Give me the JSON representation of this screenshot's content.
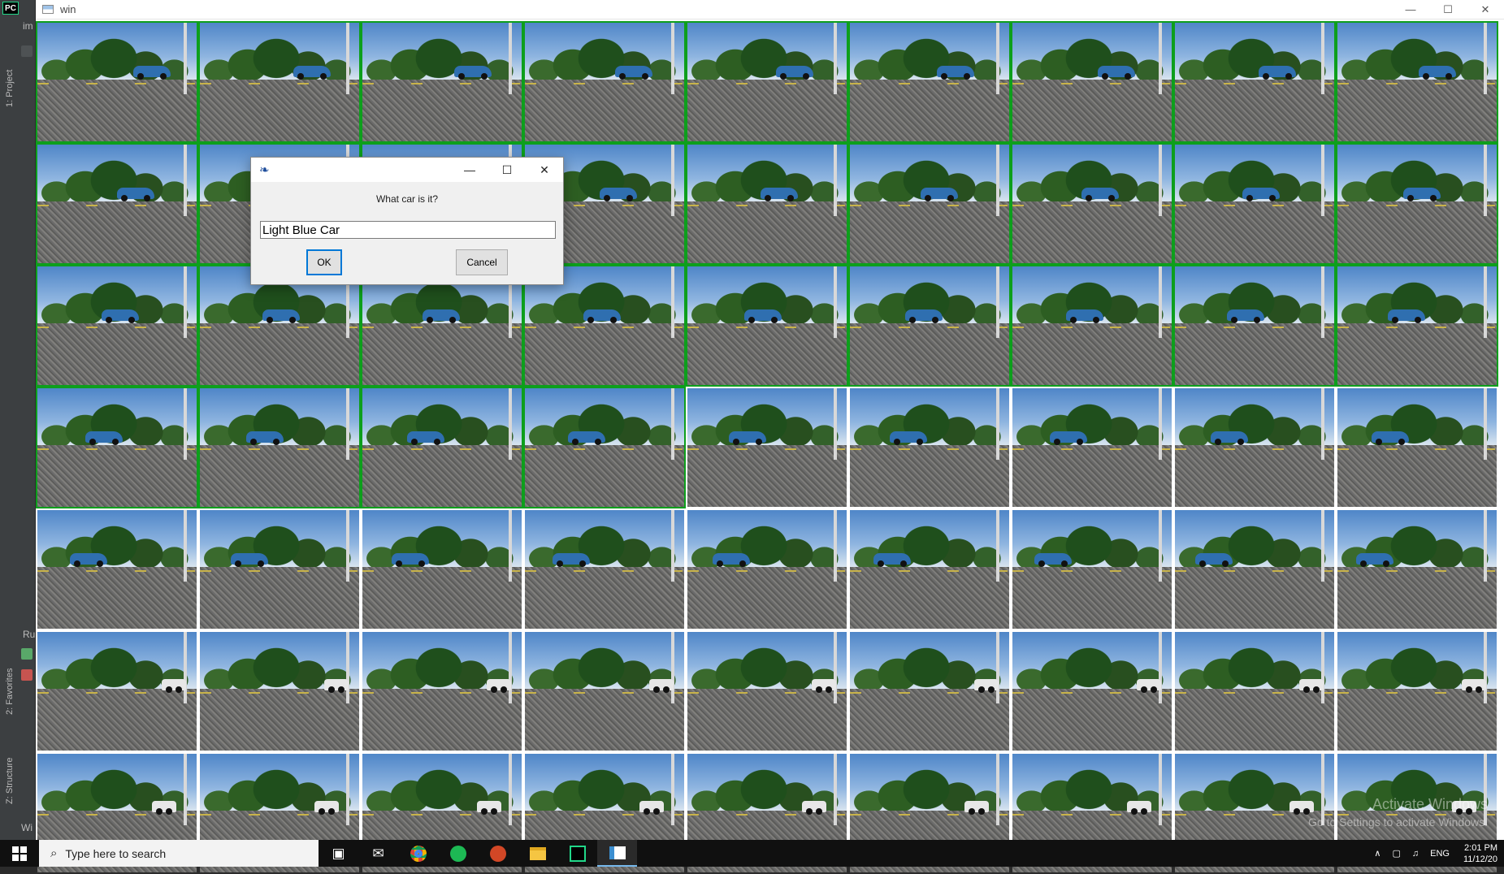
{
  "ide": {
    "logo": "PC",
    "project_tab": "1: Project",
    "favorites_tab": "2: Favorites",
    "structure_tab": "Z: Structure",
    "run_label": "Ru",
    "bottom_label": "Wi",
    "file_label": "im"
  },
  "window": {
    "title": "win",
    "controls": {
      "minimize": "—",
      "maximize": "☐",
      "close": "✕"
    }
  },
  "grid": {
    "columns": 9,
    "rows": 7,
    "selected_rows": [
      [
        true,
        true,
        true,
        true,
        true,
        true,
        true,
        true,
        true
      ],
      [
        true,
        true,
        true,
        true,
        true,
        true,
        true,
        true,
        true
      ],
      [
        true,
        true,
        true,
        true,
        true,
        true,
        true,
        true,
        true
      ],
      [
        true,
        true,
        true,
        true,
        false,
        false,
        false,
        false,
        false
      ],
      [
        false,
        false,
        false,
        false,
        false,
        false,
        false,
        false,
        false
      ],
      [
        false,
        false,
        false,
        false,
        false,
        false,
        false,
        false,
        false
      ],
      [
        false,
        false,
        false,
        false,
        false,
        false,
        false,
        false,
        false
      ]
    ]
  },
  "dialog": {
    "icon": "feather-icon",
    "controls": {
      "minimize": "—",
      "maximize": "☐",
      "close": "✕"
    },
    "prompt": "What car is it?",
    "input_value": "Light Blue Car",
    "ok_label": "OK",
    "cancel_label": "Cancel"
  },
  "watermark": {
    "line1": "Activate Windows",
    "line2": "Go to Settings to activate Windows."
  },
  "taskbar": {
    "search_placeholder": "Type here to search",
    "language": "ENG",
    "time": "2:01 PM",
    "date": "11/12/20"
  }
}
